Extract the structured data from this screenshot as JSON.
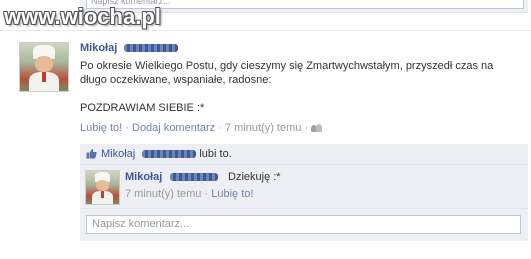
{
  "previous_comment_placeholder": "Napisz komentarz...",
  "watermark": "www.wiocha.pl",
  "post": {
    "author": "Mikołaj",
    "text_line1": "Po okresie Wielkiego Postu, gdy cieszymy się Zmartwychwstałym, przyszedł czas na",
    "text_line2": "długo oczekiwane, wspaniałe, radosne:",
    "text_line3": "POZDRAWIAM SIEBIE :*",
    "like_label": "Lubię to!",
    "sep": "·",
    "comment_label": "Dodaj komentarz",
    "time": "7 minut(y) temu",
    "audience_icon": "people-icon"
  },
  "likes": {
    "name": "Mikołaj",
    "text": "lubi to.",
    "icon": "thumbs-up-icon"
  },
  "comment": {
    "author": "Mikołaj",
    "text": "Dziekuję :*",
    "time": "7 minut(y) temu",
    "sep": "·",
    "like_label": "Lubię to!"
  },
  "comment_input": {
    "placeholder": "Napisz komentarz..."
  },
  "colors": {
    "link": "#3b5998",
    "meta_link": "#6d84b4",
    "panel": "#edeff4"
  }
}
